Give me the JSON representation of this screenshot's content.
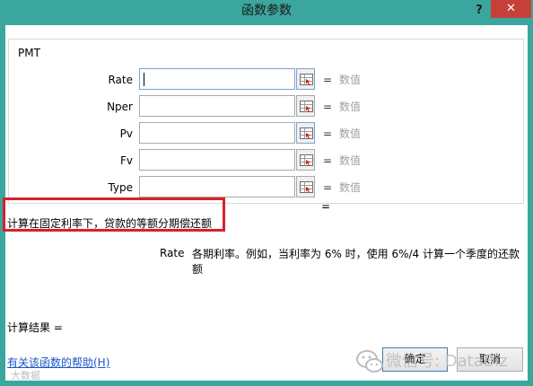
{
  "window": {
    "title": "函数参数",
    "help_glyph": "?",
    "close_glyph": "✕"
  },
  "function": {
    "name": "PMT",
    "args": [
      {
        "label": "Rate",
        "value": "",
        "equals": "=",
        "result": "数值"
      },
      {
        "label": "Nper",
        "value": "",
        "equals": "=",
        "result": "数值"
      },
      {
        "label": "Pv",
        "value": "",
        "equals": "=",
        "result": "数值"
      },
      {
        "label": "Fv",
        "value": "",
        "equals": "=",
        "result": "数值"
      },
      {
        "label": "Type",
        "value": "",
        "equals": "=",
        "result": "数值"
      }
    ],
    "result_equals": "=",
    "description": "计算在固定利率下，贷款的等额分期偿还额",
    "param_name": "Rate",
    "param_description": "各期利率。例如，当利率为 6% 时，使用 6%/4 计算一个季度的还款额"
  },
  "footer": {
    "result_label": "计算结果 =",
    "help_link": "有关该函数的帮助(H)",
    "ok_label": "确定",
    "cancel_label": "取消"
  },
  "watermark": {
    "text": "微信号: DataBiz",
    "small_text": "大数据"
  },
  "colors": {
    "frame": "#3aa69e",
    "close_button": "#c6403a",
    "highlight_box": "#d9202a",
    "link": "#1a56c9"
  }
}
